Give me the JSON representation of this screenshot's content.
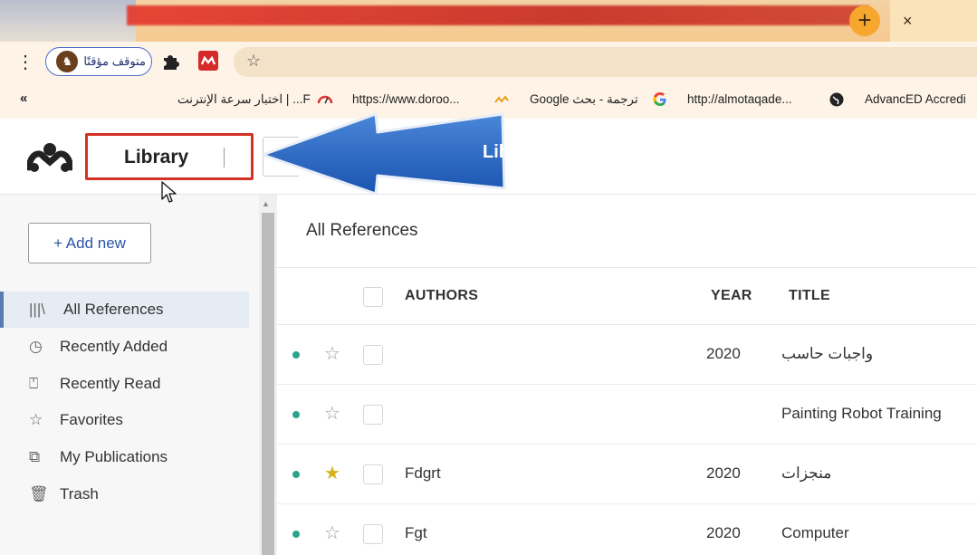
{
  "browser": {
    "new_tab": "+",
    "close_tab": "×",
    "menu": "⋮",
    "paused_profile": "متوقف مؤقتًا",
    "bookmarks_expand": "«",
    "bookmarks": [
      {
        "label": "F... | اختبار سرعة الإنترنت"
      },
      {
        "label": "https://www.doroo..."
      },
      {
        "label": "Google ترجمة - بحث"
      },
      {
        "label": "http://almotaqade..."
      },
      {
        "label": "AdvancED Accredi"
      }
    ]
  },
  "app": {
    "library_tab": "Library",
    "callout_text": "من تبويب  Library",
    "add_new": "+ Add new",
    "sidebar": [
      {
        "label": "All References",
        "icon": "library-icon",
        "active": true
      },
      {
        "label": "Recently Added",
        "icon": "clock-icon"
      },
      {
        "label": "Recently Read",
        "icon": "bookmark-icon"
      },
      {
        "label": "Favorites",
        "icon": "star-icon"
      },
      {
        "label": "My Publications",
        "icon": "publications-icon"
      },
      {
        "label": "Trash",
        "icon": "trash-icon"
      }
    ],
    "main_title": "All References",
    "columns": {
      "authors": "AUTHORS",
      "year": "YEAR",
      "title": "TITLE"
    },
    "rows": [
      {
        "authors": "",
        "year": "2020",
        "title": "واجبات حاسب",
        "favorite": false
      },
      {
        "authors": "",
        "year": "",
        "title": "Painting Robot Training",
        "favorite": false
      },
      {
        "authors": "Fdgrt",
        "year": "2020",
        "title": "منجزات",
        "favorite": true
      },
      {
        "authors": "Fgt",
        "year": "2020",
        "title": "Computer",
        "favorite": false
      }
    ]
  },
  "colors": {
    "accent_blue": "#2b55a5",
    "highlight_red": "#d33124",
    "unread_dot": "#2aa58c",
    "favorite_star": "#d5b11b"
  }
}
